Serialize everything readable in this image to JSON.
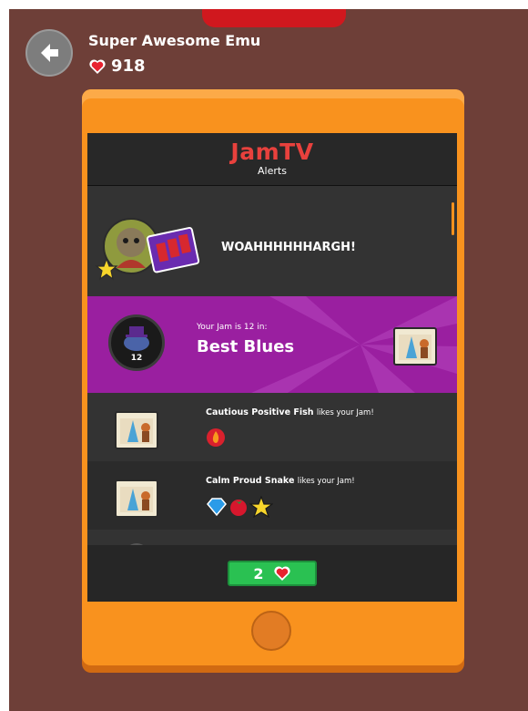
{
  "header": {
    "user_name": "Super Awesome Emu",
    "heart_count": "918"
  },
  "screen": {
    "logo_text_jam": "Jam",
    "logo_text_tv": "TV",
    "subtitle": "Alerts"
  },
  "alerts": [
    {
      "type": "message",
      "text": "WOAHHHHHHARGH!"
    },
    {
      "type": "rank",
      "line1": "Your Jam is 12 in:",
      "line2": "Best Blues",
      "rank": "12"
    },
    {
      "type": "like",
      "name": "Cautious Positive Fish",
      "suffix": "likes your Jam!",
      "reactions": [
        "fire-icon"
      ]
    },
    {
      "type": "like",
      "name": "Calm Proud Snake",
      "suffix": "likes your Jam!",
      "reactions": [
        "diamond-icon",
        "tomato-icon",
        "star-icon"
      ]
    }
  ],
  "footer": {
    "like_count": "2"
  },
  "colors": {
    "background": "#6e3f38",
    "device": "#f9921e",
    "rank_banner": "#9a1fa0",
    "count_pill": "#2ac152",
    "heart": "#e8222f",
    "logo": "#e8413d"
  }
}
